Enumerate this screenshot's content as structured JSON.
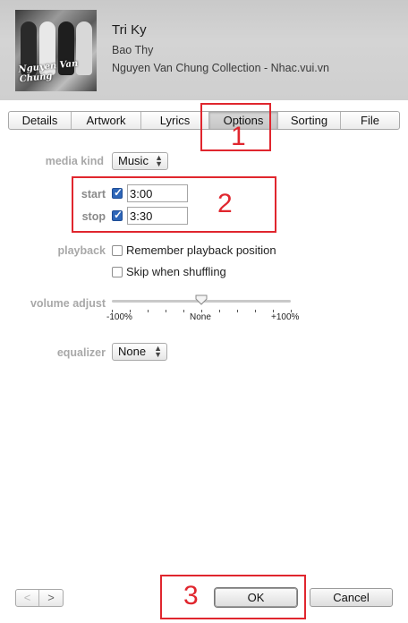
{
  "header": {
    "title": "Tri Ky",
    "artist": "Bao Thy",
    "album": "Nguyen Van Chung Collection - Nhac.vui.vn",
    "artwork_caption": "Nguyen Van Chung"
  },
  "tabs": [
    {
      "label": "Details"
    },
    {
      "label": "Artwork"
    },
    {
      "label": "Lyrics"
    },
    {
      "label": "Options",
      "active": true
    },
    {
      "label": "Sorting"
    },
    {
      "label": "File"
    }
  ],
  "options": {
    "media_kind_label": "media kind",
    "media_kind_value": "Music",
    "start_label": "start",
    "start_checked": true,
    "start_value": "3:00",
    "stop_label": "stop",
    "stop_checked": true,
    "stop_value": "3:30",
    "playback_label": "playback",
    "remember_position_label": "Remember playback position",
    "remember_position_checked": false,
    "skip_shuffle_label": "Skip when shuffling",
    "skip_shuffle_checked": false,
    "volume_label": "volume adjust",
    "volume_min_label": "-100%",
    "volume_mid_label": "None",
    "volume_max_label": "+100%",
    "volume_value_percent": 0,
    "equalizer_label": "equalizer",
    "equalizer_value": "None"
  },
  "annotations": [
    "1",
    "2",
    "3"
  ],
  "footer": {
    "prev_glyph": "<",
    "next_glyph": ">",
    "ok_label": "OK",
    "cancel_label": "Cancel"
  },
  "colors": {
    "annotation_red": "#e0262e",
    "checkbox_blue": "#2e66b8"
  }
}
